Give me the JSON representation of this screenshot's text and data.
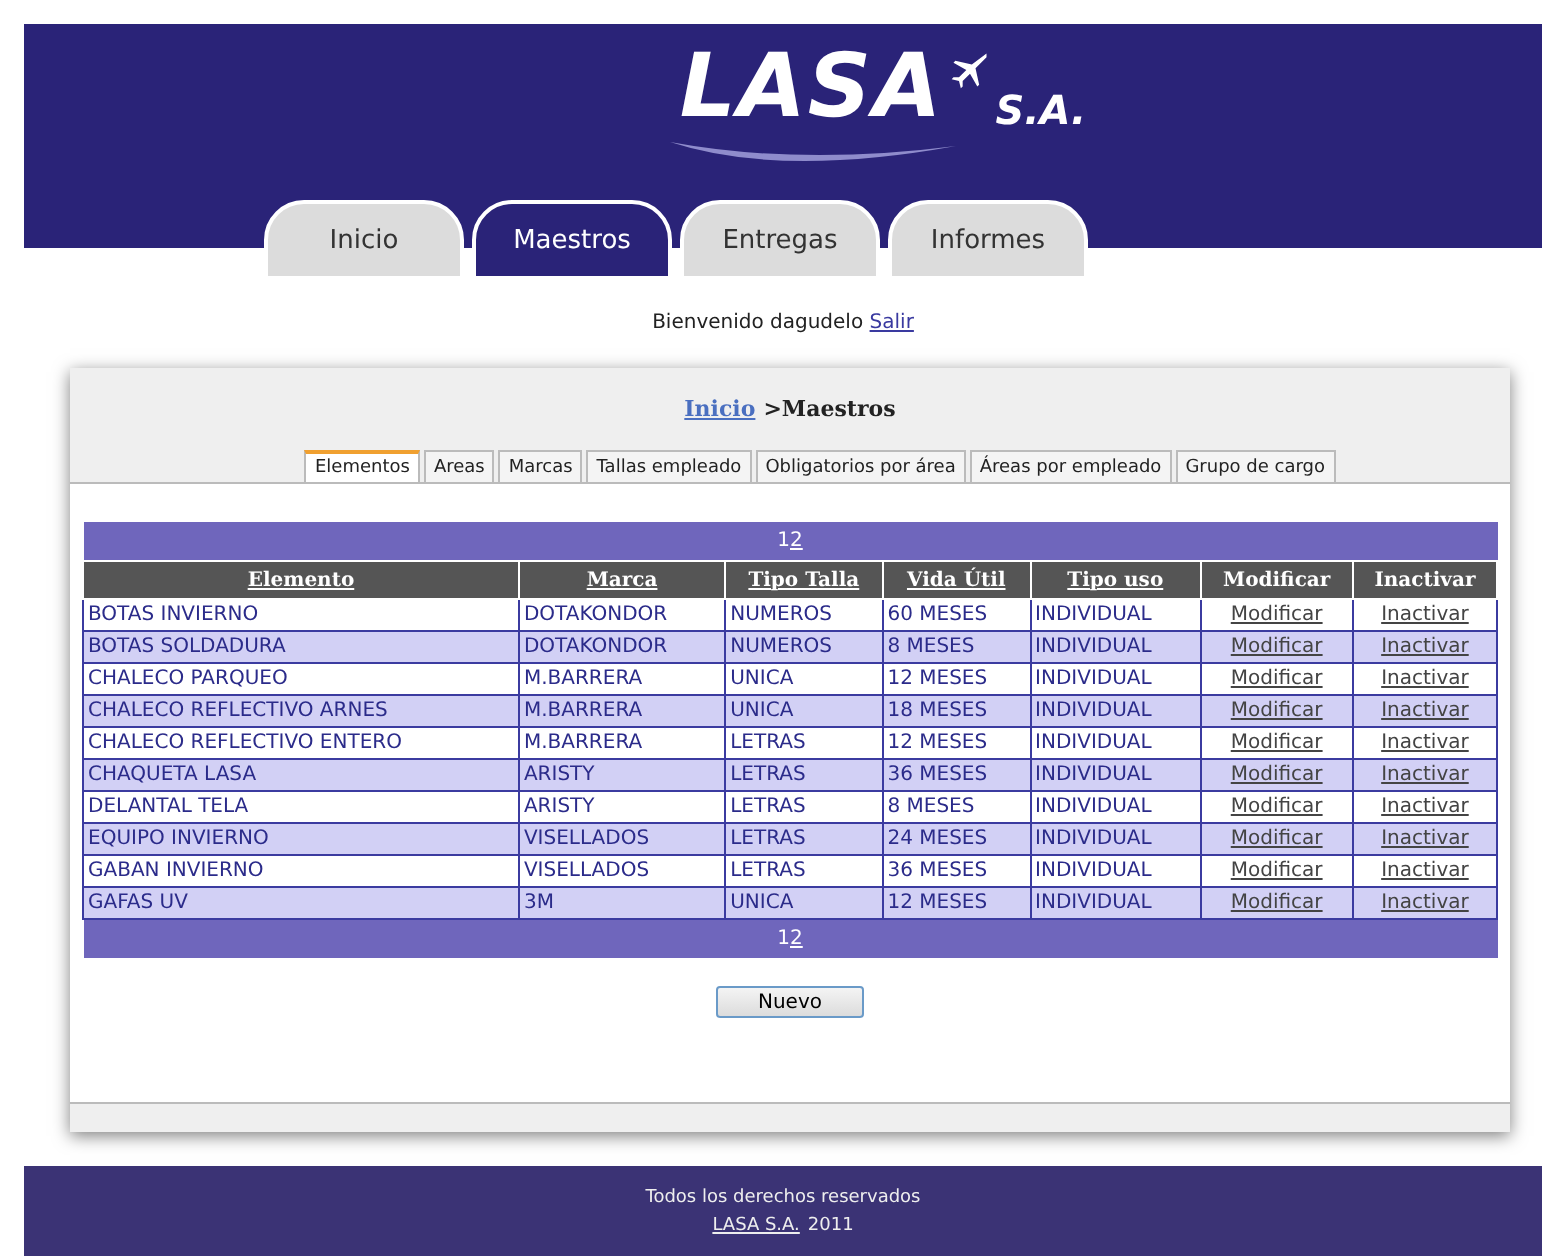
{
  "logo": {
    "name": "LASA",
    "suffix": "S.A."
  },
  "nav_tabs": [
    {
      "label": "Inicio",
      "selected": false
    },
    {
      "label": "Maestros",
      "selected": true
    },
    {
      "label": "Entregas",
      "selected": false
    },
    {
      "label": "Informes",
      "selected": false
    }
  ],
  "welcome": {
    "text": "Bienvenido dagudelo",
    "link": "Salir"
  },
  "breadcrumb": {
    "link": "Inicio",
    "current": ">Maestros"
  },
  "sub_tabs": [
    {
      "label": "Elementos",
      "selected": true
    },
    {
      "label": "Areas",
      "selected": false
    },
    {
      "label": "Marcas",
      "selected": false
    },
    {
      "label": "Tallas empleado",
      "selected": false
    },
    {
      "label": "Obligatorios por área",
      "selected": false
    },
    {
      "label": "Áreas por empleado",
      "selected": false
    },
    {
      "label": "Grupo de cargo",
      "selected": false
    }
  ],
  "pager_top": [
    {
      "label": "1",
      "selected": true
    },
    {
      "label": "2",
      "selected": false
    }
  ],
  "pager_bottom": [
    {
      "label": "1",
      "selected": true
    },
    {
      "label": "2",
      "selected": false
    }
  ],
  "table": {
    "columns": [
      {
        "label": "Elemento",
        "sortable": true
      },
      {
        "label": "Marca",
        "sortable": true
      },
      {
        "label": "Tipo Talla",
        "sortable": true
      },
      {
        "label": "Vida Útil",
        "sortable": true
      },
      {
        "label": "Tipo uso",
        "sortable": true
      },
      {
        "label": "Modificar",
        "sortable": false
      },
      {
        "label": "Inactivar",
        "sortable": false
      }
    ],
    "rows": [
      [
        "BOTAS INVIERNO",
        "DOTAKONDOR",
        "NUMEROS",
        "60 MESES",
        "INDIVIDUAL",
        "Modificar",
        "Inactivar"
      ],
      [
        "BOTAS SOLDADURA",
        "DOTAKONDOR",
        "NUMEROS",
        "8 MESES",
        "INDIVIDUAL",
        "Modificar",
        "Inactivar"
      ],
      [
        "CHALECO PARQUEO",
        "M.BARRERA",
        "UNICA",
        "12 MESES",
        "INDIVIDUAL",
        "Modificar",
        "Inactivar"
      ],
      [
        "CHALECO REFLECTIVO ARNES",
        "M.BARRERA",
        "UNICA",
        "18 MESES",
        "INDIVIDUAL",
        "Modificar",
        "Inactivar"
      ],
      [
        "CHALECO REFLECTIVO ENTERO",
        "M.BARRERA",
        "LETRAS",
        "12 MESES",
        "INDIVIDUAL",
        "Modificar",
        "Inactivar"
      ],
      [
        "CHAQUETA LASA",
        "ARISTY",
        "LETRAS",
        "36 MESES",
        "INDIVIDUAL",
        "Modificar",
        "Inactivar"
      ],
      [
        "DELANTAL TELA",
        "ARISTY",
        "LETRAS",
        "8 MESES",
        "INDIVIDUAL",
        "Modificar",
        "Inactivar"
      ],
      [
        "EQUIPO INVIERNO",
        "VISELLADOS",
        "LETRAS",
        "24 MESES",
        "INDIVIDUAL",
        "Modificar",
        "Inactivar"
      ],
      [
        "GABAN INVIERNO",
        "VISELLADOS",
        "LETRAS",
        "36 MESES",
        "INDIVIDUAL",
        "Modificar",
        "Inactivar"
      ],
      [
        "GAFAS UV",
        "3M",
        "UNICA",
        "12 MESES",
        "INDIVIDUAL",
        "Modificar",
        "Inactivar"
      ]
    ]
  },
  "new_button": "Nuevo",
  "footer": {
    "text": "Todos los derechos reservados",
    "link": "LASA S.A.",
    "year": "2011"
  }
}
